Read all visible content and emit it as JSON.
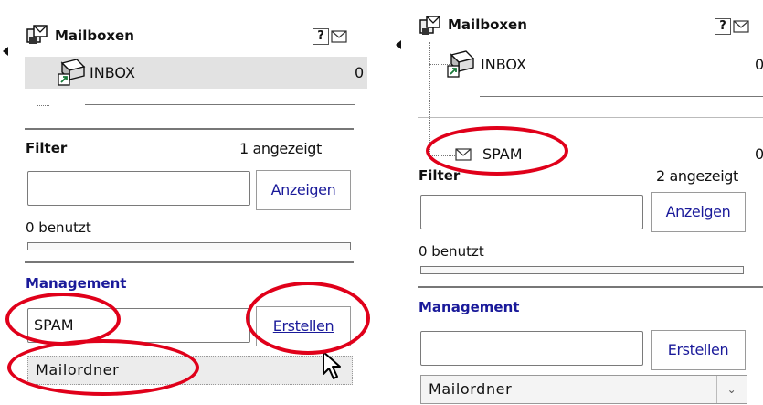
{
  "left": {
    "mailboxes_title": "Mailboxen",
    "help_label": "?",
    "inbox_label": "INBOX",
    "inbox_count": "0",
    "filter_label": "Filter",
    "filter_shown": "1 angezeigt",
    "filter_input_value": "",
    "anzeigen_label": "Anzeigen",
    "usage_text": "0 benutzt",
    "usage_fraction": 0,
    "management_label": "Management",
    "new_folder_value": "SPAM",
    "erstellen_label": "Erstellen",
    "select_value": "Mailordner"
  },
  "right": {
    "mailboxes_title": "Mailboxen",
    "help_label": "?",
    "inbox_label": "INBOX",
    "inbox_count": "0",
    "spam_label": "SPAM",
    "spam_count": "0",
    "filter_label": "Filter",
    "filter_shown": "2 angezeigt",
    "filter_input_value": "",
    "anzeigen_label": "Anzeigen",
    "usage_text": "0 benutzt",
    "usage_fraction": 0,
    "management_label": "Management",
    "new_folder_value": "",
    "erstellen_label": "Erstellen",
    "select_value": "Mailordner"
  },
  "colors": {
    "accent": "#1a1a9a",
    "highlight_ellipse": "#e0001a",
    "inbox_row_bg": "#e2e2e2"
  }
}
